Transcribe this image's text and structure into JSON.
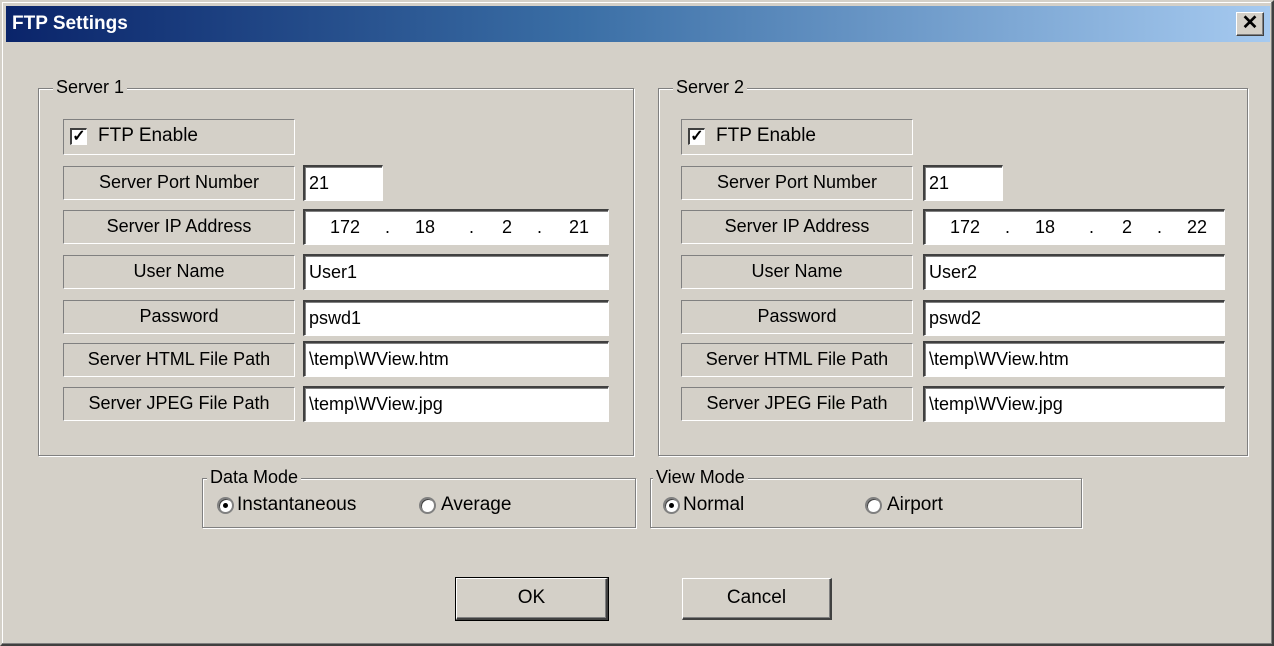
{
  "window": {
    "title": "FTP Settings",
    "close_label": "✕"
  },
  "server1": {
    "legend": "Server 1",
    "ftp_enable_label": "FTP Enable",
    "ftp_enable_checked": true,
    "port_label": "Server Port Number",
    "port_value": "21",
    "ip_label": "Server IP Address",
    "ip": [
      "172",
      "18",
      "2",
      "21"
    ],
    "user_label": "User Name",
    "user_value": "User1",
    "password_label": "Password",
    "password_value": "pswd1",
    "html_label": "Server HTML File Path",
    "html_value": "\\temp\\WView.htm",
    "jpeg_label": "Server JPEG File Path",
    "jpeg_value": "\\temp\\WView.jpg"
  },
  "server2": {
    "legend": "Server 2",
    "ftp_enable_label": "FTP Enable",
    "ftp_enable_checked": true,
    "port_label": "Server Port Number",
    "port_value": "21",
    "ip_label": "Server IP Address",
    "ip": [
      "172",
      "18",
      "2",
      "22"
    ],
    "user_label": "User Name",
    "user_value": "User2",
    "password_label": "Password",
    "password_value": "pswd2",
    "html_label": "Server HTML File Path",
    "html_value": "\\temp\\WView.htm",
    "jpeg_label": "Server JPEG File Path",
    "jpeg_value": "\\temp\\WView.jpg"
  },
  "data_mode": {
    "legend": "Data Mode",
    "options": [
      "Instantaneous",
      "Average"
    ],
    "selected": "Instantaneous"
  },
  "view_mode": {
    "legend": "View Mode",
    "options": [
      "Normal",
      "Airport"
    ],
    "selected": "Normal"
  },
  "buttons": {
    "ok": "OK",
    "cancel": "Cancel"
  },
  "colors": {
    "face": "#d4d0c8",
    "title_start": "#0a246a",
    "title_end": "#a6caf0"
  },
  "icons": {
    "check": "check-icon",
    "close": "close-icon"
  }
}
